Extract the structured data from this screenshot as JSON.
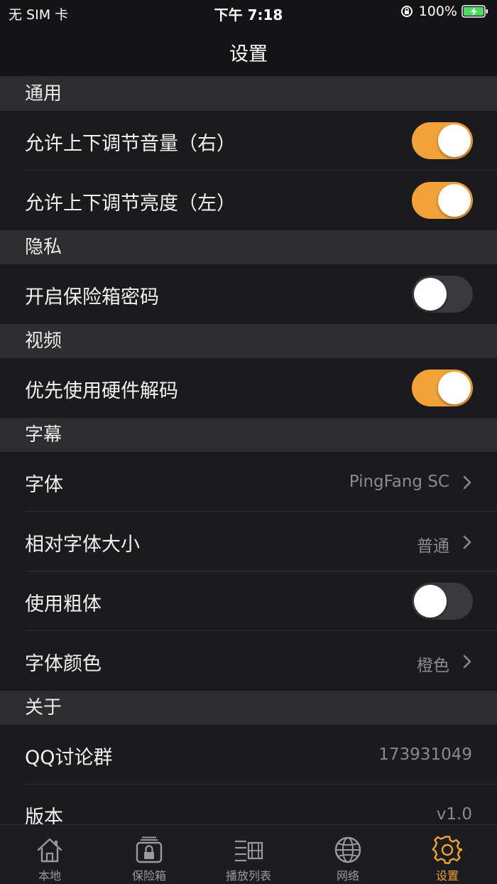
{
  "status_bar": {
    "carrier": "无 SIM 卡",
    "time": "下午 7:18",
    "battery": "100%"
  },
  "nav": {
    "title": "设置"
  },
  "colors": {
    "accent": "#f1a23a",
    "background": "#1b1b1d",
    "section": "#2d2d30"
  },
  "sections": {
    "general": {
      "header": "通用",
      "volume": {
        "label": "允许上下调节音量（右）",
        "on": true
      },
      "brightness": {
        "label": "允许上下调节亮度（左）",
        "on": true
      }
    },
    "privacy": {
      "header": "隐私",
      "vault_password": {
        "label": "开启保险箱密码",
        "on": false
      }
    },
    "video": {
      "header": "视频",
      "hw_decode": {
        "label": "优先使用硬件解码",
        "on": true
      }
    },
    "subtitles": {
      "header": "字幕",
      "font": {
        "label": "字体",
        "value": "PingFang SC"
      },
      "size": {
        "label": "相对字体大小",
        "value": "普通"
      },
      "bold": {
        "label": "使用粗体",
        "on": false
      },
      "color": {
        "label": "字体颜色",
        "value": "橙色"
      }
    },
    "about": {
      "header": "关于",
      "qq": {
        "label": "QQ讨论群",
        "value": "173931049"
      },
      "version": {
        "label": "版本",
        "value": "v1.0"
      }
    }
  },
  "tabbar": {
    "items": [
      {
        "label": "本地",
        "icon": "home-icon"
      },
      {
        "label": "保险箱",
        "icon": "vault-lock-icon"
      },
      {
        "label": "播放列表",
        "icon": "playlist-icon"
      },
      {
        "label": "网络",
        "icon": "globe-icon"
      },
      {
        "label": "设置",
        "icon": "gear-icon",
        "active": true
      }
    ]
  }
}
